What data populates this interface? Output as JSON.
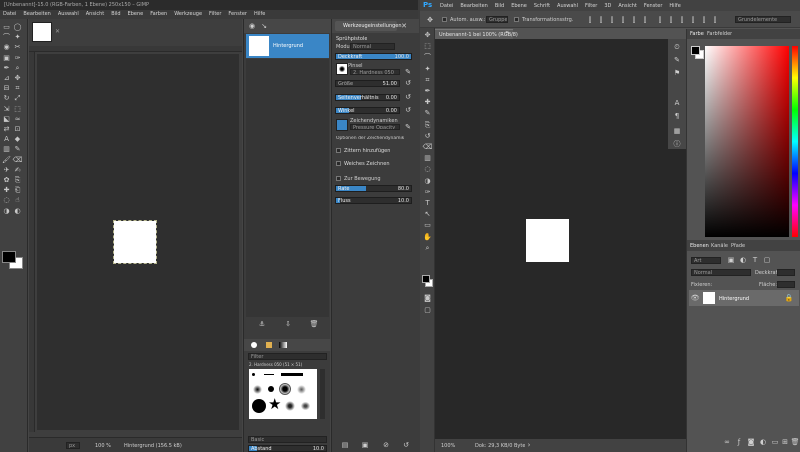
{
  "gimp": {
    "title": "[Unbenannt]-15.0 (RGB-Farben, 1 Ebene) 250x150 – GIMP",
    "menu": [
      "Datei",
      "Bearbeiten",
      "Auswahl",
      "Ansicht",
      "Bild",
      "Ebene",
      "Farben",
      "Werkzeuge",
      "Filter",
      "Fenster",
      "Hilfe"
    ],
    "status": {
      "zoom": "100 %",
      "layer": "Hintergrund (156.5 kB)"
    },
    "layers": {
      "layer_name": "Hintergrund"
    },
    "tool_options": {
      "tab": "Werkzeugeinstellungen",
      "title": "Sprühpistole",
      "mode_label": "Modus",
      "mode_value": "Normal",
      "opacity_label": "Deckkraft",
      "opacity_value": "100.0",
      "opacity_fraction": 1.0,
      "brush_label": "Pinsel",
      "brush_value": "2. Hardness 050",
      "size_label": "Größe",
      "size_value": "51.00",
      "aspect_label": "Seitenverhältnis",
      "aspect_value": "0.00",
      "aspect_fraction": 0.4,
      "angle_label": "Winkel",
      "angle_value": "0.00",
      "angle_fraction": 0.2,
      "dynamics_label": "Zeichendynamiken",
      "dynamics_value": "Pressure Opacity",
      "dynamics_options": "Optionen der Zeichendynamik",
      "jitter": "Zittern hinzufügen",
      "smooth": "Weiches Zeichnen",
      "incremental": "Zur Bewegung",
      "rate_label": "Rate",
      "rate_value": "80.0",
      "rate_fraction": 0.4,
      "flow_label": "Fluss",
      "flow_value": "10.0",
      "flow_fraction": 0.05
    },
    "brushes": {
      "filter": "Filter",
      "brush_name": "2. Hardness 050 (51 × 51)",
      "tag": "Basic",
      "spacing_label": "Abstand",
      "spacing_value": "10.0"
    }
  },
  "photoshop": {
    "logo": "Ps",
    "menu": [
      "Datei",
      "Bearbeiten",
      "Bild",
      "Ebene",
      "Schrift",
      "Auswahl",
      "Filter",
      "3D",
      "Ansicht",
      "Fenster",
      "Hilfe"
    ],
    "options": {
      "auto_select": "Autom. ausw.:",
      "group": "Gruppe",
      "transform": "Transformationsstrg.",
      "workspace": "Grundelemente"
    },
    "document_tab": "Unbenannt-1 bei 100% (RGB/8)",
    "status": {
      "zoom": "100%",
      "doc": "Dok: 29,3 KB/0 Byte"
    },
    "color_panel": {
      "tabs": [
        "Farbe",
        "Farbfelder"
      ]
    },
    "layers_panel": {
      "tabs": [
        "Ebenen",
        "Kanäle",
        "Pfade"
      ],
      "kind": "Art",
      "blend": "Normal",
      "opacity_label": "Deckkraft:",
      "lock_label": "Fixieren:",
      "fill_label": "Fläche:",
      "layer_name": "Hintergrund"
    }
  },
  "colors": {
    "bg": "#3c3c3c",
    "canvas_bg": "#2b2b2b",
    "accent": "#3a86c6",
    "white": "#ffffff"
  }
}
